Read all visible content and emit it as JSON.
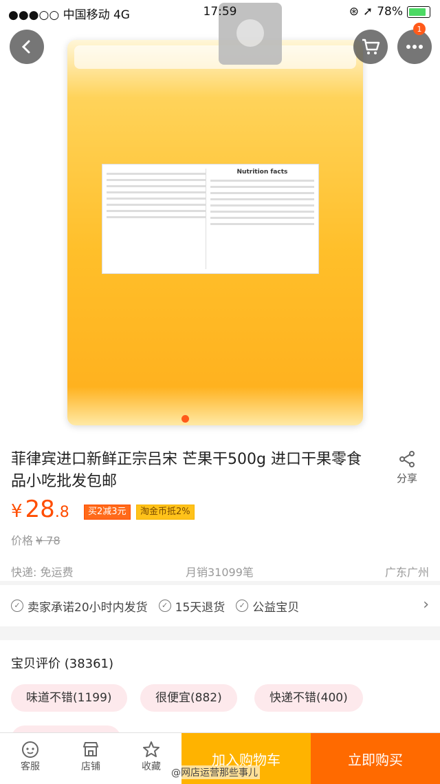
{
  "status_bar": {
    "carrier": "●●●○○ 中国移动  4G",
    "time": "17:59",
    "battery": "78%"
  },
  "header": {
    "cart_badge": "1"
  },
  "gallery": {
    "label_heading": "Nutrition facts"
  },
  "product": {
    "title": "菲律宾进口新鲜正宗吕宋 芒果干500g 进口干果零食品小吃批发包邮",
    "share_label": "分享",
    "price_currency": "¥",
    "price_int": "28",
    "price_dec": ".8",
    "promo_tag": "买2减3元",
    "coin_tag": "淘金币抵2%",
    "orig_label": "价格",
    "orig_price": "¥ 78",
    "shipping": "快递: 免运费",
    "monthly_sales": "月销31099笔",
    "location": "广东广州"
  },
  "promises": [
    "卖家承诺20小时内发货",
    "15天退货",
    "公益宝贝"
  ],
  "reviews": {
    "title": "宝贝评价 (38361)",
    "tags": [
      "味道不错(1199)",
      "很便宜(882)",
      "快递不错(400)"
    ]
  },
  "bottom_bar": {
    "service": "客服",
    "shop": "店铺",
    "favorite": "收藏",
    "add_to_cart": "加入购物车",
    "buy_now": "立即购买",
    "watermark": "@网店运营那些事儿"
  }
}
